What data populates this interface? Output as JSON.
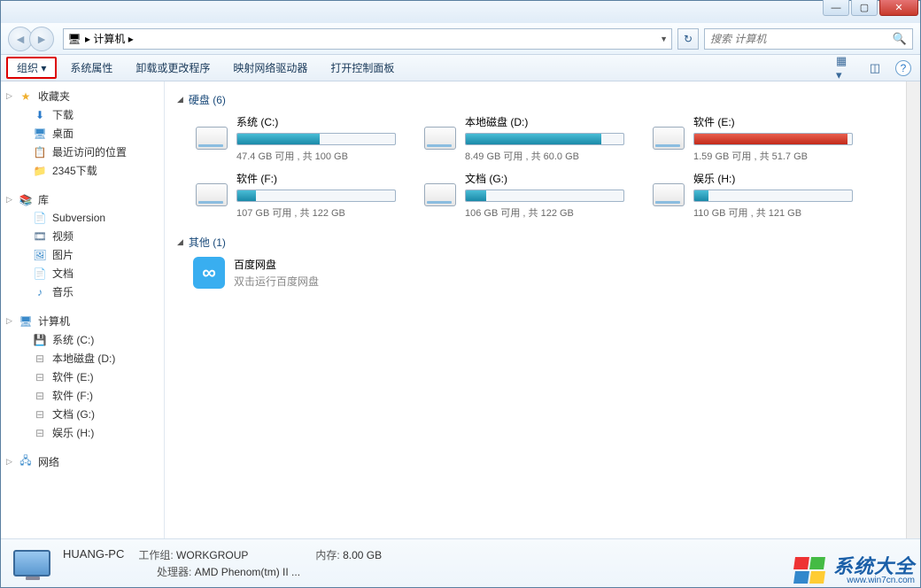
{
  "nav": {
    "path": "▸ 计算机 ▸",
    "refresh_icon": "↻"
  },
  "search": {
    "placeholder": "搜索 计算机",
    "icon": "🔍"
  },
  "toolbar": {
    "organize": "组织 ▾",
    "buttons": [
      "系统属性",
      "卸载或更改程序",
      "映射网络驱动器",
      "打开控制面板"
    ],
    "help_icon": "?"
  },
  "sidebar": {
    "favorites": {
      "label": "收藏夹",
      "items": [
        {
          "icon": "⬇",
          "color": "#2a7aca",
          "label": "下载"
        },
        {
          "icon": "🖥",
          "color": "#3a8aca",
          "label": "桌面"
        },
        {
          "icon": "📋",
          "color": "#888",
          "label": "最近访问的位置"
        },
        {
          "icon": "📁",
          "color": "#e8c060",
          "label": "2345下载"
        }
      ]
    },
    "library": {
      "label": "库",
      "items": [
        {
          "icon": "📄",
          "color": "#888",
          "label": "Subversion"
        },
        {
          "icon": "🎞",
          "color": "#4a6a8a",
          "label": "视频"
        },
        {
          "icon": "🖼",
          "color": "#3a8aca",
          "label": "图片"
        },
        {
          "icon": "📄",
          "color": "#888",
          "label": "文档"
        },
        {
          "icon": "♪",
          "color": "#3a8aca",
          "label": "音乐"
        }
      ]
    },
    "computer": {
      "label": "计算机",
      "items": [
        {
          "icon": "💾",
          "color": "#5a8aba",
          "label": "系统 (C:)"
        },
        {
          "icon": "⊟",
          "color": "#999",
          "label": "本地磁盘 (D:)"
        },
        {
          "icon": "⊟",
          "color": "#999",
          "label": "软件 (E:)"
        },
        {
          "icon": "⊟",
          "color": "#999",
          "label": "软件 (F:)"
        },
        {
          "icon": "⊟",
          "color": "#999",
          "label": "文档 (G:)"
        },
        {
          "icon": "⊟",
          "color": "#999",
          "label": "娱乐 (H:)"
        }
      ]
    },
    "network": {
      "label": "网络"
    }
  },
  "content": {
    "hdd_header": "硬盘 (6)",
    "drives": [
      {
        "name": "系统 (C:)",
        "text": "47.4 GB 可用 , 共 100 GB",
        "fill": 52,
        "red": false
      },
      {
        "name": "本地磁盘 (D:)",
        "text": "8.49 GB 可用 , 共 60.0 GB",
        "fill": 86,
        "red": false
      },
      {
        "name": "软件 (E:)",
        "text": "1.59 GB 可用 , 共 51.7 GB",
        "fill": 97,
        "red": true
      },
      {
        "name": "软件 (F:)",
        "text": "107 GB 可用 , 共 122 GB",
        "fill": 12,
        "red": false
      },
      {
        "name": "文档 (G:)",
        "text": "106 GB 可用 , 共 122 GB",
        "fill": 13,
        "red": false
      },
      {
        "name": "娱乐 (H:)",
        "text": "110 GB 可用 , 共 121 GB",
        "fill": 9,
        "red": false
      }
    ],
    "other_header": "其他 (1)",
    "other": {
      "name": "百度网盘",
      "sub": "双击运行百度网盘"
    }
  },
  "details": {
    "name": "HUANG-PC",
    "workgroup_lbl": "工作组:",
    "workgroup": "WORKGROUP",
    "memory_lbl": "内存:",
    "memory": "8.00 GB",
    "cpu_lbl": "处理器:",
    "cpu": "AMD Phenom(tm) II ..."
  },
  "watermark": {
    "title": "系统大全",
    "url": "www.win7cn.com"
  }
}
